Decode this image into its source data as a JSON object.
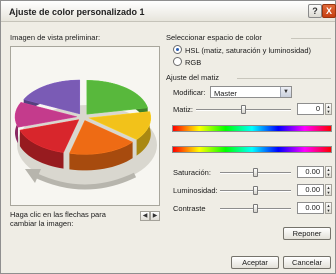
{
  "window": {
    "title": "Ajuste de color personalizado 1",
    "help": "?",
    "close": "X"
  },
  "preview": {
    "label": "Imagen de vista preliminar:",
    "nav_hint": "Haga clic en las flechas para cambiar la imagen:",
    "nav_prev": "◀",
    "nav_next": "▶"
  },
  "color_space": {
    "group_label": "Seleccionar espacio de color",
    "options": [
      {
        "label": "HSL (matiz, saturación y luminosidad)",
        "selected": true
      },
      {
        "label": "RGB",
        "selected": false
      }
    ]
  },
  "hue_adjust": {
    "group_label": "Ajuste del matiz",
    "modify_label": "Modificar:",
    "modify_value": "Master",
    "dropdown_arrow": "▼",
    "hue_label": "Matiz:",
    "hue_value": "0",
    "hue_level": 0.5
  },
  "sliders": [
    {
      "label": "Saturación:",
      "value": "0.00",
      "level": 0.5
    },
    {
      "label": "Luminosidad:",
      "value": "0.00",
      "level": 0.5
    },
    {
      "label": "Contraste",
      "value": "0.00",
      "level": 0.5
    }
  ],
  "spin": {
    "up": "▲",
    "down": "▼"
  },
  "buttons": {
    "reset": "Reponer",
    "accept": "Aceptar",
    "cancel": "Cancelar"
  },
  "pie_chart": {
    "slices": [
      {
        "label": "verde",
        "value": 22,
        "color": "#58b83c"
      },
      {
        "label": "amarillo",
        "value": 14,
        "color": "#f2c21a"
      },
      {
        "label": "naranja",
        "value": 18,
        "color": "#ee6b14"
      },
      {
        "label": "rojo",
        "value": 16,
        "color": "#d8262c"
      },
      {
        "label": "magenta",
        "value": 12,
        "color": "#c43b8c"
      },
      {
        "label": "violeta",
        "value": 18,
        "color": "#7a5bb5"
      }
    ]
  }
}
